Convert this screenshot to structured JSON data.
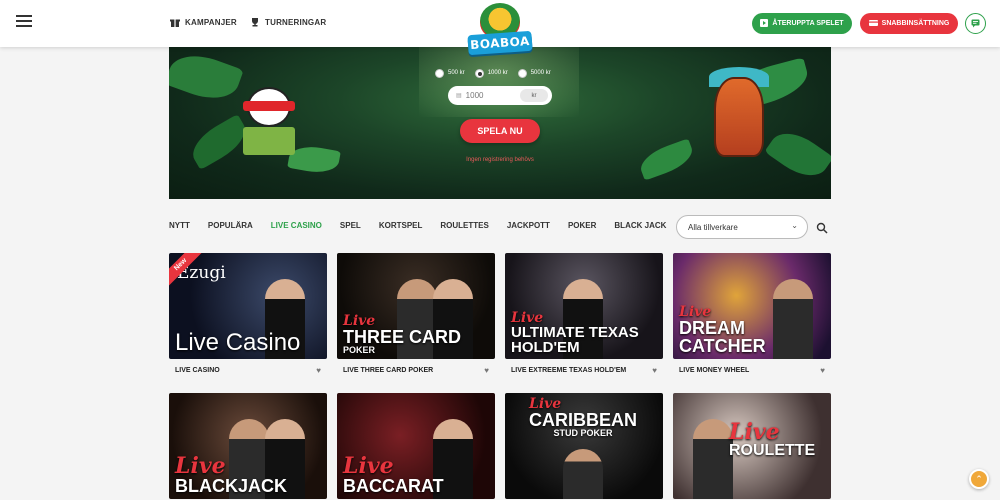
{
  "header": {
    "nav": [
      {
        "label": "KAMPANJER",
        "icon": "gift-icon"
      },
      {
        "label": "TURNERINGAR",
        "icon": "trophy-icon"
      }
    ],
    "logo_text": "BOABOA",
    "resume_label": "ÅTERUPPTA SPELET",
    "quick_deposit_label": "SNABBINSÄTTNING",
    "chat_icon": "chat-icon"
  },
  "banner": {
    "bet_options": [
      {
        "label": "500 kr",
        "selected": false
      },
      {
        "label": "1000 kr",
        "selected": true
      },
      {
        "label": "5000 kr",
        "selected": false
      }
    ],
    "amount_value": "1000",
    "amount_currency": "kr",
    "play_label": "SPELA NU",
    "no_registration": "Ingen registrering behövs"
  },
  "categories": {
    "items": [
      "NYTT",
      "POPULÄRA",
      "LIVE CASINO",
      "SPEL",
      "KORTSPEL",
      "ROULETTES",
      "JACKPOTT",
      "POKER",
      "BLACK JACK"
    ],
    "active": "LIVE CASINO",
    "favorites_icon": "heart-icon",
    "provider_placeholder": "Alla tillverkare",
    "search_icon": "search-icon"
  },
  "games": [
    {
      "name": "LIVE CASINO",
      "thumb_live": "",
      "thumb_main": "Live Casino",
      "thumb_sub": "",
      "badge": "New",
      "brand": "Ezugi",
      "bg": "bg1"
    },
    {
      "name": "LIVE THREE CARD POKER",
      "thumb_live": "Live",
      "thumb_main": "THREE CARD",
      "thumb_sub": "POKER",
      "badge": "",
      "brand": "",
      "bg": "bg2"
    },
    {
      "name": "LIVE EXTREEME TEXAS HOLD'EM",
      "thumb_live": "Live",
      "thumb_main": "ULTIMATE TEXAS",
      "thumb_sub": "HOLD'EM",
      "badge": "",
      "brand": "",
      "bg": "bg3"
    },
    {
      "name": "LIVE MONEY WHEEL",
      "thumb_live": "Live",
      "thumb_main": "DREAM CATCHER",
      "thumb_sub": "",
      "badge": "",
      "brand": "",
      "bg": "bg4"
    },
    {
      "name": "",
      "thumb_live": "Live",
      "thumb_main": "BLACKJACK",
      "thumb_sub": "",
      "badge": "",
      "brand": "",
      "bg": "bg5"
    },
    {
      "name": "",
      "thumb_live": "Live",
      "thumb_main": "BACCARAT",
      "thumb_sub": "",
      "badge": "",
      "brand": "",
      "bg": "bg6"
    },
    {
      "name": "",
      "thumb_live": "Live",
      "thumb_main": "CARIBBEAN",
      "thumb_sub": "STUD POKER",
      "badge": "",
      "brand": "",
      "bg": "bg7"
    },
    {
      "name": "",
      "thumb_live": "Live",
      "thumb_main": "ROULETTE",
      "thumb_sub": "",
      "badge": "",
      "brand": "",
      "bg": "bg8"
    }
  ],
  "colors": {
    "accent_green": "#2ea14b",
    "accent_red": "#e8353e",
    "brand_blue": "#1a9fd9"
  }
}
